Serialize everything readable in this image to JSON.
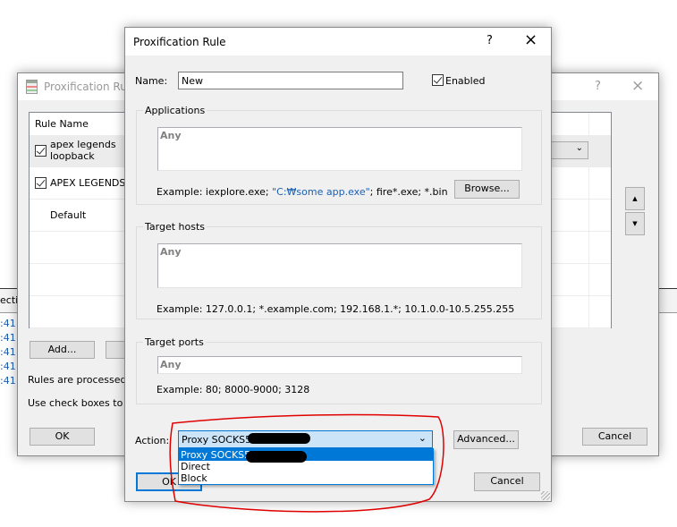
{
  "background_window": {
    "title": "Proxification Rules",
    "help": "?",
    "close": "×",
    "column_header": "Rule Name",
    "rules": [
      {
        "name": "apex legends loopback",
        "checked": true
      },
      {
        "name": "APEX LEGENDS",
        "checked": true
      },
      {
        "name": "Default",
        "checked": false
      }
    ],
    "add_label": "Add...",
    "info1": "Rules are processed fr",
    "info2": "Use check boxes to ena",
    "ok_label": "OK",
    "cancel_label": "Cancel",
    "up_icon": "triangle-up-icon",
    "down_icon": "triangle-down-icon"
  },
  "left_strip": {
    "header": "ectio",
    "lines": [
      ":41:",
      ":41:",
      ":41:",
      ":41:",
      ":41:"
    ]
  },
  "dialog": {
    "title": "Proxification Rule",
    "help": "?",
    "close": "×",
    "name_label": "Name:",
    "name_value": "New",
    "enabled_label": "Enabled",
    "enabled": true,
    "applications": {
      "label": "Applications",
      "value": "Any",
      "example_pre": "Example: iexplore.exe; ",
      "example_quoted": "\"C:₩some app.exe\"",
      "example_post": "; fire*.exe; *.bin",
      "browse_label": "Browse..."
    },
    "target_hosts": {
      "label": "Target hosts",
      "value": "Any",
      "example": "Example: 127.0.0.1; *.example.com; 192.168.1.*; 10.1.0.0-10.5.255.255"
    },
    "target_ports": {
      "label": "Target ports",
      "value": "Any",
      "example": "Example: 80; 8000-9000; 3128"
    },
    "action_label": "Action:",
    "action_selected": "Proxy SOCKS5",
    "action_options": [
      "Proxy SOCKS5",
      "Direct",
      "Block"
    ],
    "advanced_label": "Advanced...",
    "ok_label": "OK",
    "cancel_label": "Cancel"
  },
  "colors": {
    "highlight": "#0078d7",
    "annotation": "#e00000",
    "select_bg": "#cce4f7"
  }
}
